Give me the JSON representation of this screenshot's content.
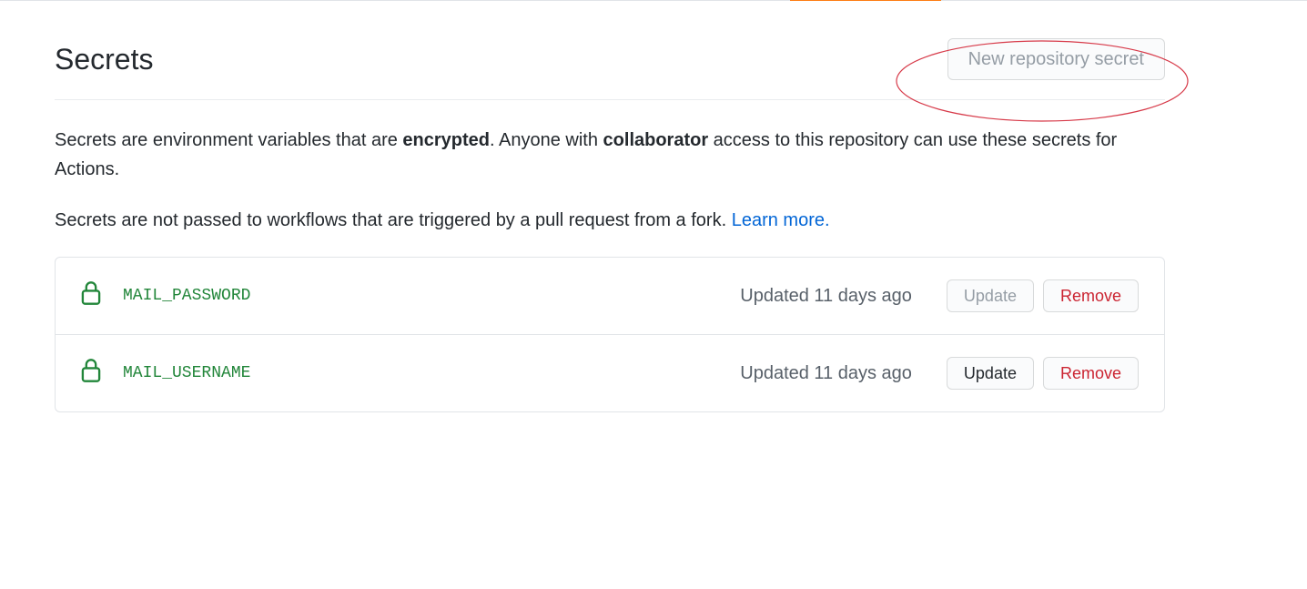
{
  "header": {
    "title": "Secrets",
    "new_secret_label": "New repository secret"
  },
  "description": {
    "intro_part1": "Secrets are environment variables that are ",
    "intro_bold1": "encrypted",
    "intro_part2": ". Anyone with ",
    "intro_bold2": "collaborator",
    "intro_part3": " access to this repository can use these secrets for Actions.",
    "para2_part1": "Secrets are not passed to workflows that are triggered by a pull request from a fork. ",
    "learn_more": "Learn more.",
    "period": ""
  },
  "secrets": [
    {
      "name": "MAIL_PASSWORD",
      "updated": "Updated 11 days ago",
      "update_label": "Update",
      "remove_label": "Remove",
      "update_disabled": true
    },
    {
      "name": "MAIL_USERNAME",
      "updated": "Updated 11 days ago",
      "update_label": "Update",
      "remove_label": "Remove",
      "update_disabled": false
    }
  ]
}
